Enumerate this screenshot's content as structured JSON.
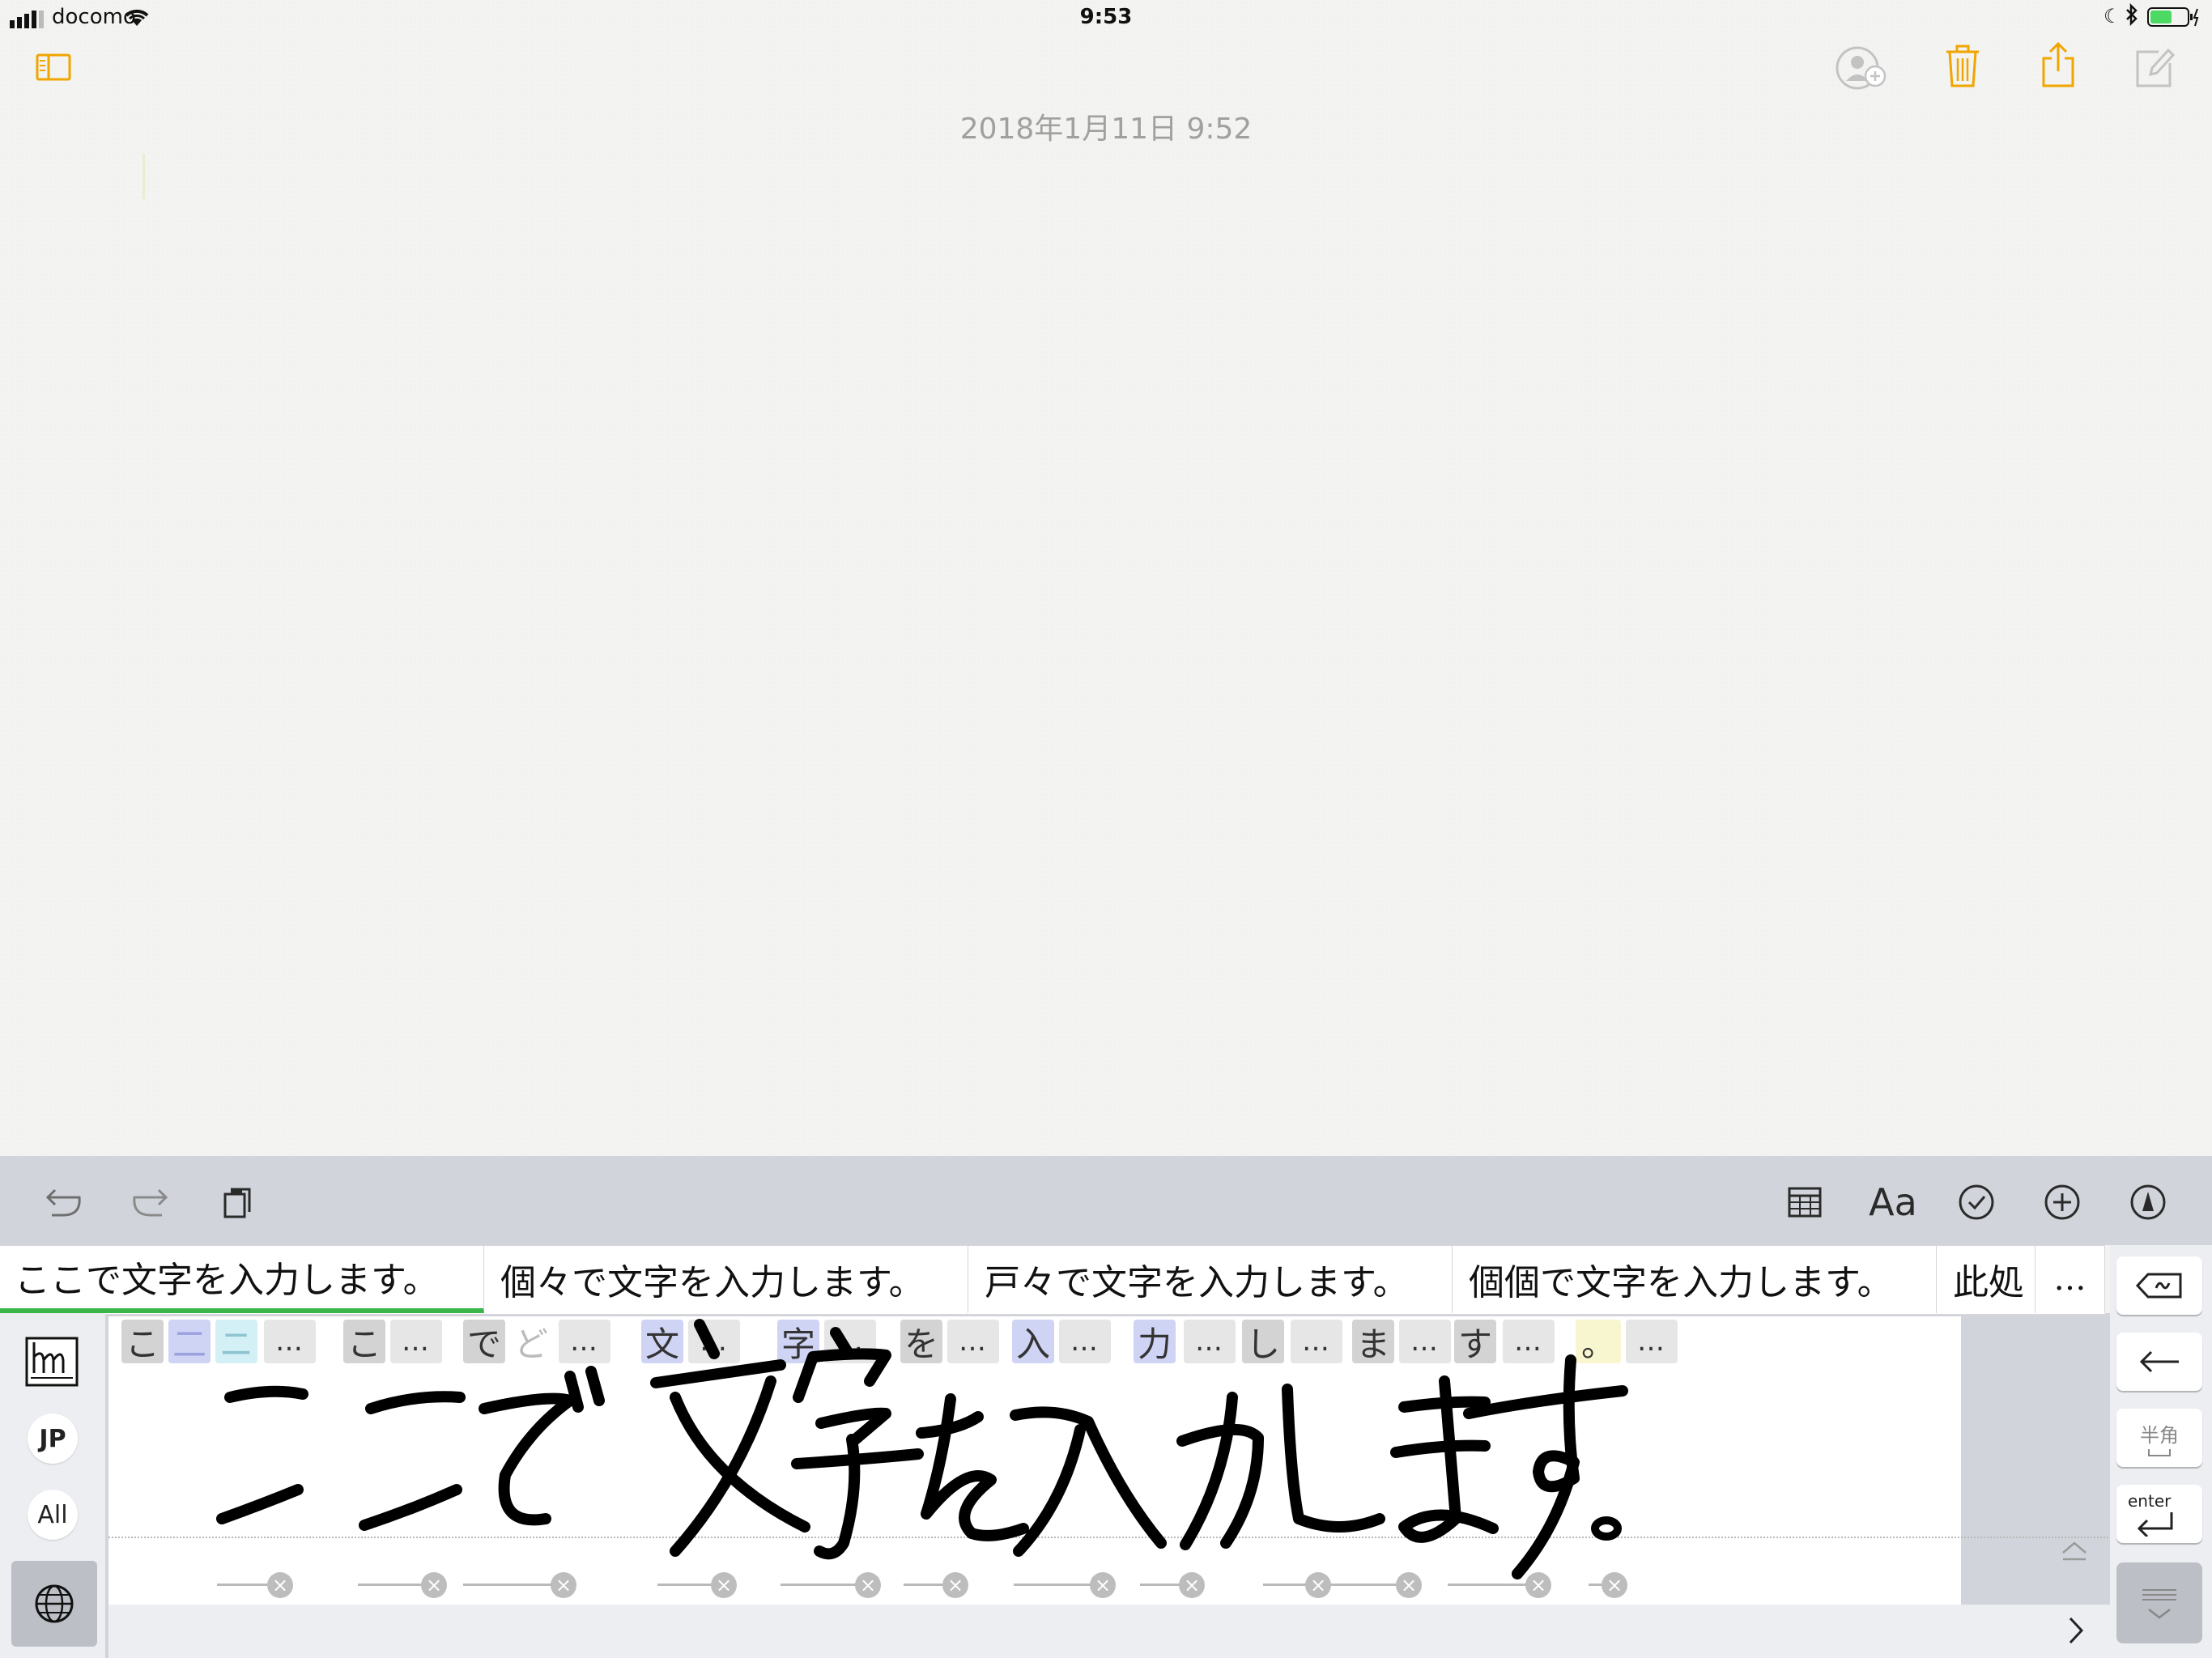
{
  "status_bar": {
    "carrier": "docomo",
    "time": "9:53"
  },
  "note": {
    "date": "2018年1月11日 9:52"
  },
  "colors": {
    "accent": "#f0a500",
    "candidate_underline": "#3ab549"
  },
  "toolbar": {
    "left_icons": [
      "undo-icon",
      "redo-icon",
      "clipboard-icon"
    ],
    "format_label": "Aa",
    "right_icons": [
      "table-icon",
      "checklist-icon",
      "add-icon",
      "markup-icon"
    ]
  },
  "candidates": [
    "ここで文字を入力します。",
    "個々で文字を入力します。",
    "戸々で文字を入力します。",
    "個個で文字を入力します。",
    "此処"
  ],
  "candidates_more": "…",
  "char_groups": {
    "c1": [
      "こ",
      "二",
      "ニ"
    ],
    "c2": [
      "こ"
    ],
    "c3": [
      "で",
      "ど"
    ],
    "c4": [
      "文"
    ],
    "c5": [
      "字"
    ],
    "c6": [
      "を"
    ],
    "c7": [
      "入"
    ],
    "c8": [
      "力"
    ],
    "c9": [
      "し"
    ],
    "c10": [
      "ま"
    ],
    "c11": [
      "す"
    ],
    "c12": [
      "。"
    ],
    "more": "…"
  },
  "left_panel": {
    "jp_label": "JP",
    "all_label": "All"
  },
  "right_panel": {
    "hankaku_label": "半角",
    "enter_label": "enter"
  }
}
